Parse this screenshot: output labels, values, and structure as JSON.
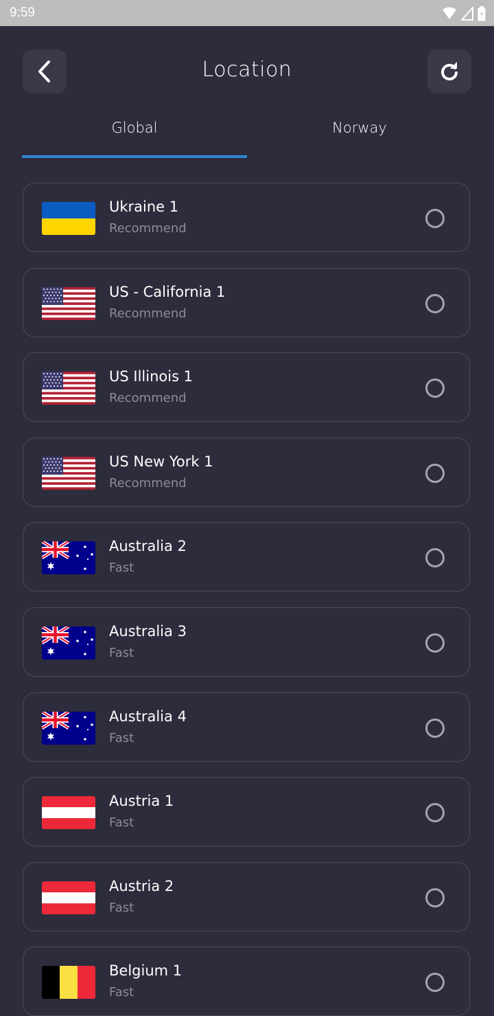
{
  "status_bar": {
    "time": "9:59"
  },
  "header": {
    "title": "Location",
    "back_icon": "chevron-left-icon",
    "refresh_icon": "refresh-icon"
  },
  "tabs": [
    {
      "label": "Global",
      "active": true
    },
    {
      "label": "Norway",
      "active": false
    }
  ],
  "colors": {
    "background": "#2d2c3c",
    "accent": "#2f86d6",
    "card_border": "#4b4a5a",
    "subtitle": "#8c8b97"
  },
  "locations": [
    {
      "name": "Ukraine 1",
      "tag": "Recommend",
      "flag": "ukraine",
      "selected": false
    },
    {
      "name": "US - California 1",
      "tag": "Recommend",
      "flag": "usa",
      "selected": false
    },
    {
      "name": "US Illinois 1",
      "tag": "Recommend",
      "flag": "usa",
      "selected": false
    },
    {
      "name": "US New York 1",
      "tag": "Recommend",
      "flag": "usa",
      "selected": false
    },
    {
      "name": "Australia 2",
      "tag": "Fast",
      "flag": "australia",
      "selected": false
    },
    {
      "name": "Australia 3",
      "tag": "Fast",
      "flag": "australia",
      "selected": false
    },
    {
      "name": "Australia 4",
      "tag": "Fast",
      "flag": "australia",
      "selected": false
    },
    {
      "name": "Austria 1",
      "tag": "Fast",
      "flag": "austria",
      "selected": false
    },
    {
      "name": "Austria 2",
      "tag": "Fast",
      "flag": "austria",
      "selected": false
    },
    {
      "name": "Belgium 1",
      "tag": "Fast",
      "flag": "belgium",
      "selected": false
    }
  ]
}
